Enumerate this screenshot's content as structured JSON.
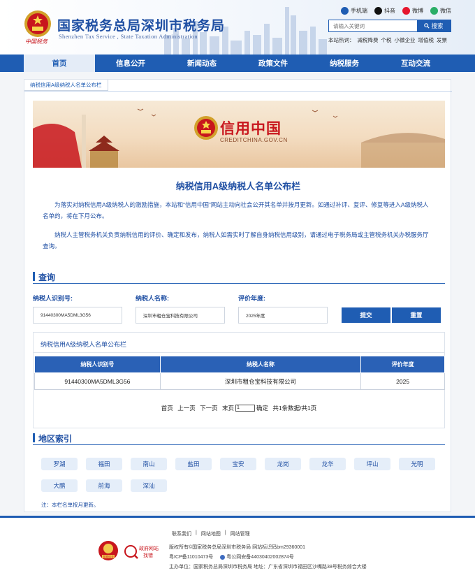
{
  "header": {
    "emblem_caption": "中国税务",
    "title": "国家税务总局深圳市税务局",
    "subtitle": "Shenzhen Tax Service , State Taxation Administration",
    "social": [
      {
        "label": "手机端",
        "icon": "mobile-icon",
        "color": "#1f5db3"
      },
      {
        "label": "抖音",
        "icon": "douyin-icon",
        "color": "#111111"
      },
      {
        "label": "微博",
        "icon": "weibo-icon",
        "color": "#e6162d"
      },
      {
        "label": "微信",
        "icon": "wechat-icon",
        "color": "#2aae67"
      }
    ],
    "search": {
      "placeholder": "请输入关键词",
      "button": "搜索"
    },
    "hotwords_label": "本站热词：",
    "hotwords": [
      "减税降费",
      "个税",
      "小微企业",
      "增值税",
      "发票"
    ]
  },
  "nav": {
    "items": [
      "首页",
      "信息公开",
      "新闻动态",
      "政策文件",
      "纳税服务",
      "互动交流"
    ],
    "active_index": 0
  },
  "breadcrumb": "纳税信用A级纳税人名单公布栏",
  "banner": {
    "title": "信用中国",
    "subtitle": "CREDITCHINA.GOV.CN"
  },
  "main": {
    "heading": "纳税信用A级纳税人名单公布栏",
    "paragraphs": [
      "为落实对纳税信用A级纳税人的激励措施，本站和“信用中国”网站主动向社会公开其名单并按月更新。如通过补评、复评、修复等进入A级纳税人名单的，将在下月公布。",
      "纳税人主管税务机关负责纳税信用的评价、确定和发布，纳税人如需实时了解自身纳税信用级别，请通过电子税务局或主管税务机关办税服务厅查询。"
    ]
  },
  "query": {
    "section_title": "查询",
    "fields": [
      {
        "label": "纳税人识别号:",
        "value": "91440300MA5DML3G56"
      },
      {
        "label": "纳税人名称:",
        "value": "深圳市粗仓宝科技有限公司"
      },
      {
        "label": "评价年度:",
        "value": "2025年度"
      }
    ],
    "submit": "提交",
    "reset": "重置"
  },
  "results": {
    "title": "纳税信用A级纳税人名单公布栏",
    "columns": [
      "纳税人识别号",
      "纳税人名称",
      "评价年度"
    ],
    "rows": [
      [
        "91440300MA5DML3G56",
        "深圳市粗仓宝科技有限公司",
        "2025"
      ]
    ],
    "pager": {
      "first": "首页",
      "prev": "上一页",
      "next": "下一页",
      "last": "末页",
      "page_value": "1",
      "confirm": "确定",
      "summary": "共1条数据/共1页"
    }
  },
  "areas": {
    "section_title": "地区索引",
    "items": [
      "罗湖",
      "福田",
      "南山",
      "盐田",
      "宝安",
      "龙岗",
      "龙华",
      "坪山",
      "光明",
      "大鹏",
      "前海",
      "深汕"
    ]
  },
  "note": "注：本栏名单按月更新。",
  "footer": {
    "links": [
      "联系我们",
      "网站地图",
      "网站管理"
    ],
    "copyright": "版权所有©国家税务总局深圳市税务局  网站标识码bm29360001",
    "icp": "粤ICP备11010473号",
    "police": "粤公网安备44030402002874号",
    "host": "主办单位：国家税务总局深圳市税务局  地址：广东省深圳市福田区沙嘴路38号税务综合大楼",
    "badge1": "党政机关",
    "badge2_line1": "政府网站",
    "badge2_line2": "找错"
  }
}
